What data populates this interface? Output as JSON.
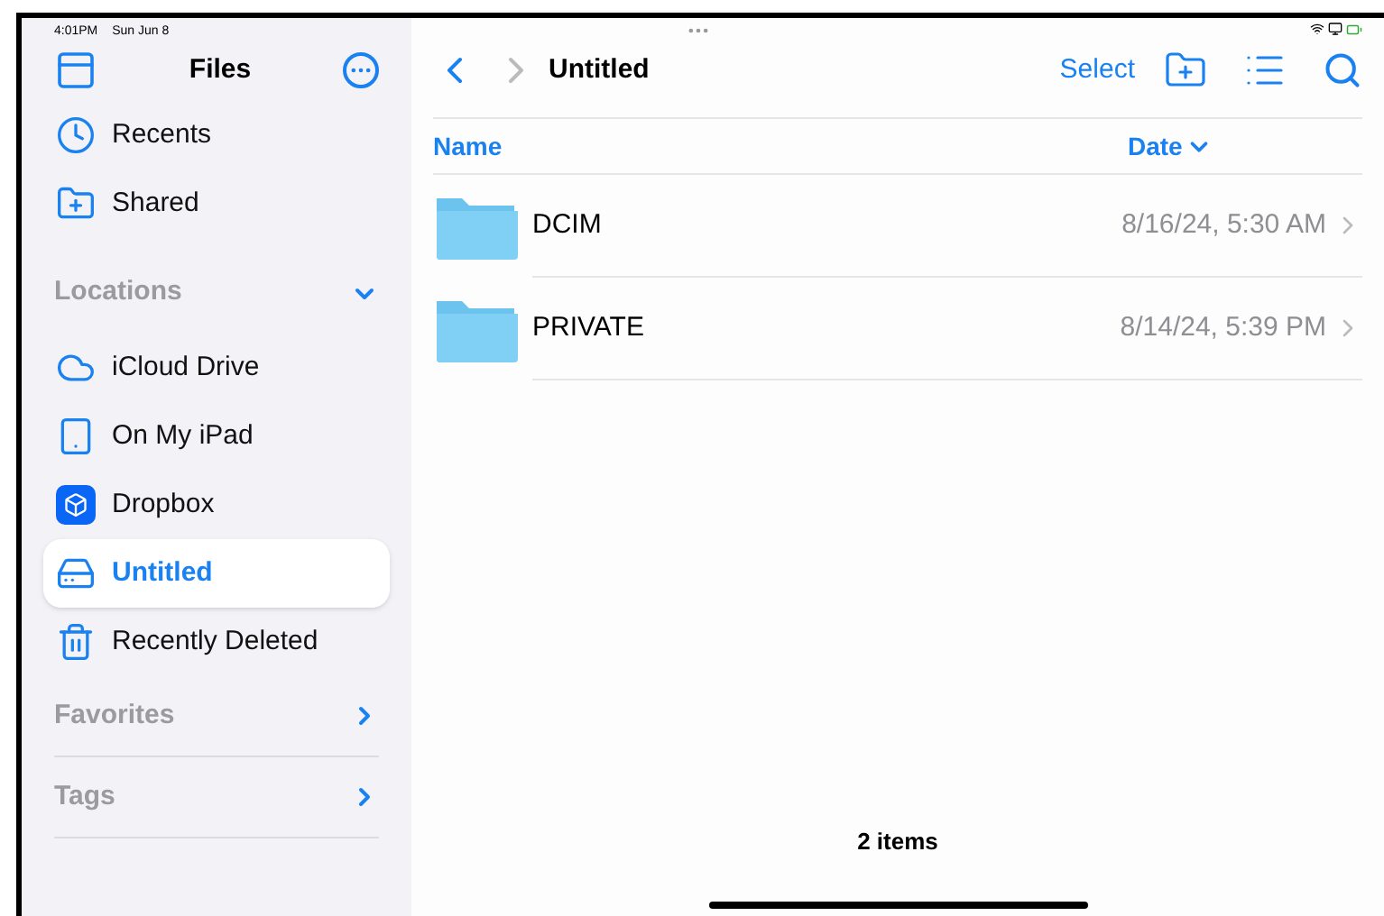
{
  "status_bar": {
    "time": "4:01PM",
    "date": "Sun Jun 8"
  },
  "sidebar": {
    "title": "Files",
    "top_items": [
      {
        "kind": "recents",
        "label": "Recents",
        "selected": false
      },
      {
        "kind": "shared",
        "label": "Shared",
        "selected": false
      }
    ],
    "sections": [
      {
        "title": "Locations",
        "expanded": true,
        "items": [
          {
            "kind": "icloud",
            "label": "iCloud Drive",
            "selected": false
          },
          {
            "kind": "ipad",
            "label": "On My iPad",
            "selected": false
          },
          {
            "kind": "dropbox",
            "label": "Dropbox",
            "selected": false
          },
          {
            "kind": "drive",
            "label": "Untitled",
            "selected": true
          },
          {
            "kind": "trash",
            "label": "Recently Deleted",
            "selected": false
          }
        ]
      },
      {
        "title": "Favorites",
        "expanded": false
      },
      {
        "title": "Tags",
        "expanded": false
      }
    ]
  },
  "toolbar": {
    "title": "Untitled",
    "select": "Select"
  },
  "table": {
    "columns": [
      {
        "label": "Name",
        "sorted": false
      },
      {
        "label": "Date",
        "sorted": true
      }
    ],
    "rows": [
      {
        "name": "DCIM",
        "date": "8/16/24, 5:30 AM"
      },
      {
        "name": "PRIVATE",
        "date": "8/14/24, 5:39 PM"
      }
    ]
  },
  "footer": {
    "count": "2 items"
  }
}
